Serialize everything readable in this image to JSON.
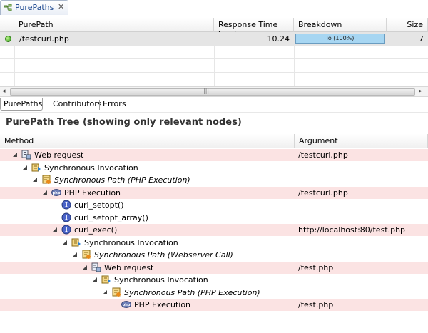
{
  "view_tab": {
    "label": "PurePaths"
  },
  "top_table": {
    "columns": [
      "PurePath",
      "Response Time [ms]",
      "Breakdown",
      "Size"
    ],
    "rows": [
      {
        "purepath": "/testcurl.php",
        "response_time": "10.24",
        "breakdown": "io (100%)",
        "size": "7"
      }
    ]
  },
  "subtabs": [
    "PurePaths",
    "Contributors",
    "Errors"
  ],
  "tree_panel": {
    "title": "PurePath Tree (showing only relevant nodes)",
    "columns": [
      "Method",
      "Argument"
    ],
    "rows": [
      {
        "method": "Web request",
        "argument": "/testcurl.php",
        "icon": "web-request-icon",
        "highlight": true,
        "italic": false
      },
      {
        "method": "Synchronous Invocation",
        "argument": "",
        "icon": "sync-invocation-icon",
        "highlight": false,
        "italic": false
      },
      {
        "method": "Synchronous Path (PHP Execution)",
        "argument": "",
        "icon": "sync-path-icon",
        "highlight": false,
        "italic": true
      },
      {
        "method": "PHP Execution",
        "argument": "/testcurl.php",
        "icon": "php-icon",
        "highlight": true,
        "italic": false
      },
      {
        "method": "curl_setopt()",
        "argument": "",
        "icon": "interface-method-icon",
        "highlight": false,
        "italic": false
      },
      {
        "method": "curl_setopt_array()",
        "argument": "",
        "icon": "interface-method-icon",
        "highlight": false,
        "italic": false
      },
      {
        "method": "curl_exec()",
        "argument": "http://localhost:80/test.php",
        "icon": "interface-method-icon",
        "highlight": true,
        "italic": false
      },
      {
        "method": "Synchronous Invocation",
        "argument": "",
        "icon": "sync-invocation-icon",
        "highlight": false,
        "italic": false
      },
      {
        "method": "Synchronous Path (Webserver Call)",
        "argument": "",
        "icon": "sync-path-icon",
        "highlight": false,
        "italic": true
      },
      {
        "method": "Web request",
        "argument": "/test.php",
        "icon": "web-request-icon",
        "highlight": true,
        "italic": false
      },
      {
        "method": "Synchronous Invocation",
        "argument": "",
        "icon": "sync-invocation-icon",
        "highlight": false,
        "italic": false
      },
      {
        "method": "Synchronous Path (PHP Execution)",
        "argument": "",
        "icon": "sync-path-icon",
        "highlight": false,
        "italic": true
      },
      {
        "method": "PHP Execution",
        "argument": "/test.php",
        "icon": "php-icon",
        "highlight": true,
        "italic": false
      }
    ]
  }
}
